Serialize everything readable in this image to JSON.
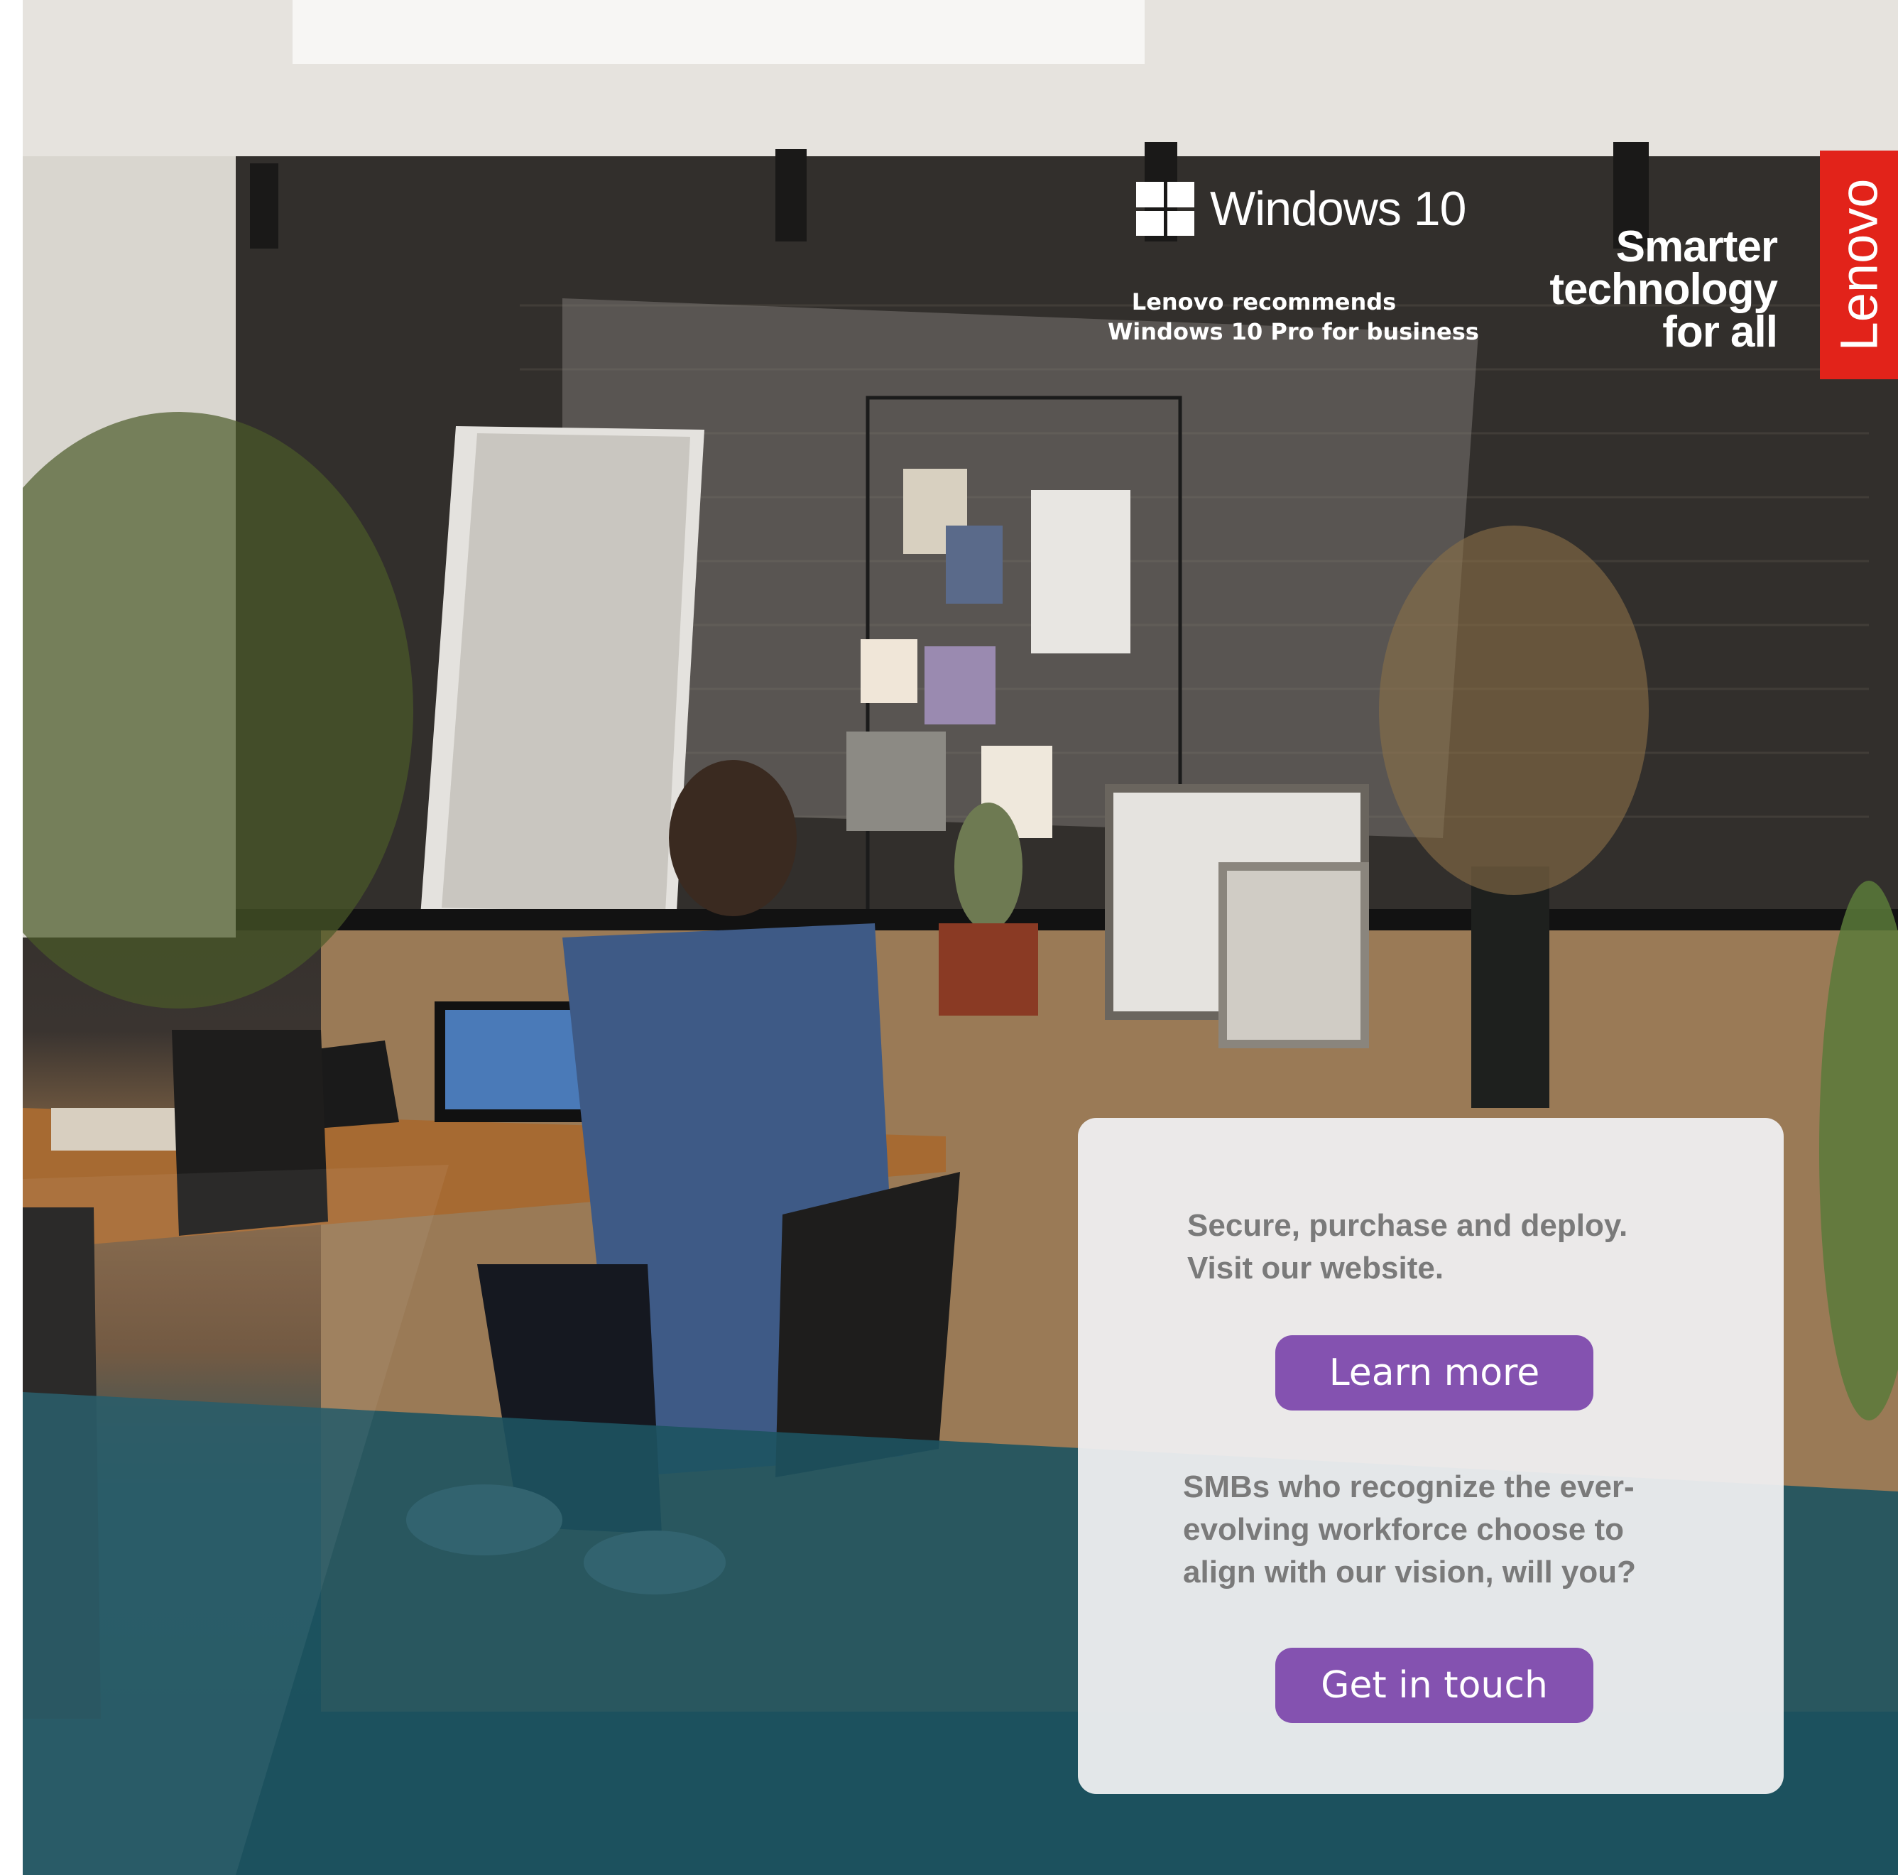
{
  "header": {
    "windows_logo_text": "Windows 10",
    "recommend_lines": [
      "Lenovo recommends",
      "Windows 10 Pro for business"
    ],
    "tagline_lines": [
      "Smarter",
      "technology",
      "for all"
    ],
    "brand": "Lenovo"
  },
  "cta": {
    "intro_lines": [
      "Secure, purchase and deploy.",
      "Visit our website."
    ],
    "learn_more_label": "Learn more",
    "pitch_lines": [
      "SMBs who recognize the ever-",
      "evolving workforce choose to",
      "align with our vision, will you?"
    ],
    "get_in_touch_label": "Get in touch"
  },
  "colors": {
    "brand_red": "#e2231a",
    "button_purple": "#8452b0",
    "panel_bg": "#f0f0f2",
    "panel_text": "#7a7a7a"
  }
}
